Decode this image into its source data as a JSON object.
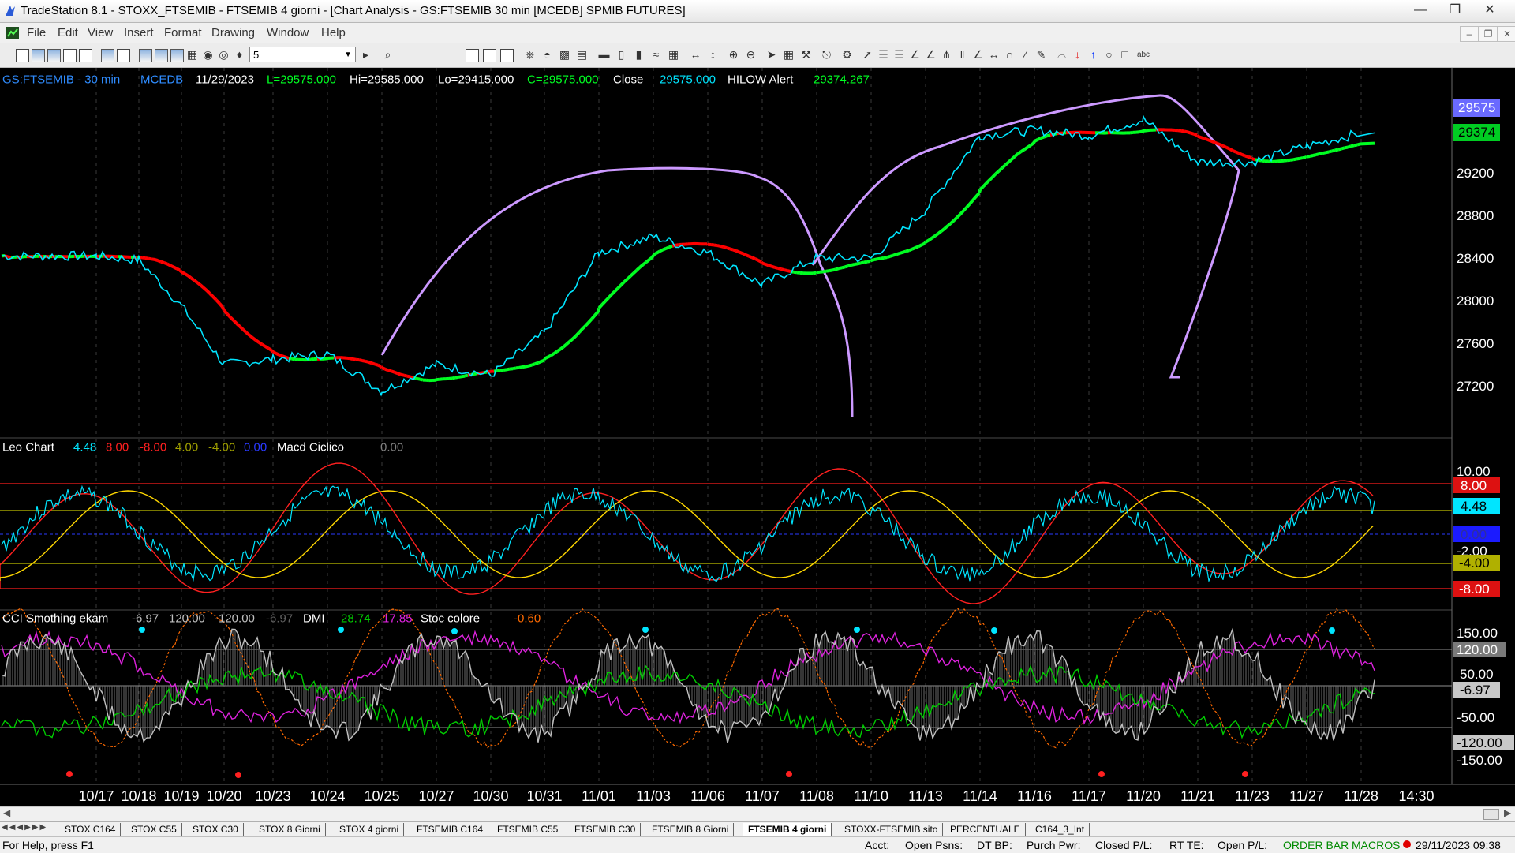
{
  "window": {
    "title": "TradeStation 8.1 - STOXX_FTSEMIB - FTSEMIB  4 giorni - [Chart Analysis - GS:FTSEMIB  30 min  [MCEDB] SPMIB FUTURES]"
  },
  "menu": [
    "File",
    "Edit",
    "View",
    "Insert",
    "Format",
    "Drawing",
    "Window",
    "Help"
  ],
  "toolbar": {
    "interval_value": "5"
  },
  "colors": {
    "price": "#00e5ff",
    "ma_up": "#00ff22",
    "ma_down": "#ff0000",
    "arc": "#cc99ff",
    "macd_fast": "#ff2020",
    "macd_slow": "#ffd700",
    "cci": "#b0b0b0",
    "dmi_plus": "#00cc00",
    "dmi_minus": "#dd22dd",
    "stoc": "#ff6a00"
  },
  "header": {
    "symbol": "GS:FTSEMIB - 30 min",
    "feed": "MCEDB",
    "date": "11/29/2023",
    "last": "L=29575.000",
    "high": "Hi=29585.000",
    "low": "Lo=29415.000",
    "close": "C=29575.000",
    "close_label": "Close",
    "close_value": "29575.000",
    "alert_label": "HILOW Alert",
    "alert_value": "29374.267"
  },
  "macd_header": {
    "name": "Leo Chart",
    "v1": "4.48",
    "v2": "8.00",
    "v3": "-8.00",
    "v4": "4.00",
    "v5": "-4.00",
    "v6": "0.00",
    "name2": "Macd Ciclico",
    "v7": "0.00"
  },
  "cci_header": {
    "name": "CCI Smothing ekam",
    "v1": "-6.97",
    "v2": "120.00",
    "v3": "-120.00",
    "v4": "-6.97",
    "dmi": "DMI",
    "dmi_plus": "28.74",
    "dmi_minus": "17.85",
    "stoc": "Stoc colore",
    "stoc_value": "-0.60"
  },
  "axis": {
    "price_ticks": [
      "29200",
      "28800",
      "28400",
      "28000",
      "27600",
      "27200"
    ],
    "price_badges": [
      "29575",
      "29374"
    ],
    "macd_ticks": [
      "10.00",
      "-2.00"
    ],
    "macd_badges": [
      "8.00",
      "4.48",
      "0.00",
      "-4.00",
      "-8.00"
    ],
    "cci_ticks": [
      "150.00",
      "50.00",
      "-50.00",
      "-150.00"
    ],
    "cci_badges": [
      "120.00",
      "-6.97",
      "-120.00"
    ],
    "dates": [
      "10/17",
      "10/18",
      "10/19",
      "10/20",
      "10/23",
      "10/24",
      "10/25",
      "10/27",
      "10/30",
      "10/31",
      "11/01",
      "11/03",
      "11/06",
      "11/07",
      "11/08",
      "11/10",
      "11/13",
      "11/14",
      "11/16",
      "11/17",
      "11/20",
      "11/21",
      "11/23",
      "11/27",
      "11/28",
      "14:30"
    ]
  },
  "chart_data": {
    "type": "line",
    "x": [
      "10/17",
      "10/18",
      "10/19",
      "10/20",
      "10/23",
      "10/24",
      "10/25",
      "10/27",
      "10/30",
      "10/31",
      "11/01",
      "11/03",
      "11/06",
      "11/07",
      "11/08",
      "11/10",
      "11/13",
      "11/14",
      "11/16",
      "11/17",
      "11/20",
      "11/21",
      "11/23",
      "11/27",
      "11/28"
    ],
    "series": [
      {
        "name": "Close",
        "values": [
          28420,
          28380,
          27950,
          27400,
          27450,
          27500,
          27150,
          27400,
          27300,
          27700,
          28450,
          28600,
          28450,
          28150,
          28400,
          28400,
          28850,
          29550,
          29600,
          29550,
          29700,
          29300,
          29300,
          29450,
          29575
        ]
      }
    ],
    "ylim": [
      27000,
      29900
    ]
  },
  "tabs": [
    {
      "label": "STOX C164"
    },
    {
      "label": "STOX C55"
    },
    {
      "label": "STOX  C30"
    },
    {
      "label": "STOX  8 Giorni"
    },
    {
      "label": "STOX 4 giorni"
    },
    {
      "label": "FTSEMIB C164"
    },
    {
      "label": "FTSEMIB C55"
    },
    {
      "label": "FTSEMIB C30"
    },
    {
      "label": "FTSEMIB  8 Giorni"
    },
    {
      "label": "FTSEMIB  4 giorni"
    },
    {
      "label": "STOXX-FTSEMIB sito"
    },
    {
      "label": "PERCENTUALE"
    },
    {
      "label": "C164_3_Int"
    }
  ],
  "status": {
    "help": "For Help, press F1",
    "acct": "Acct:",
    "open_psns": "Open Psns:",
    "dt_bp": "DT BP:",
    "purch_pwr": "Purch Pwr:",
    "closed_pl": "Closed P/L:",
    "rt_te": "RT TE:",
    "open_pl": "Open P/L:",
    "order_bar": "ORDER BAR",
    "macros": "MACROS",
    "datetime": "29/11/2023 09:38"
  }
}
